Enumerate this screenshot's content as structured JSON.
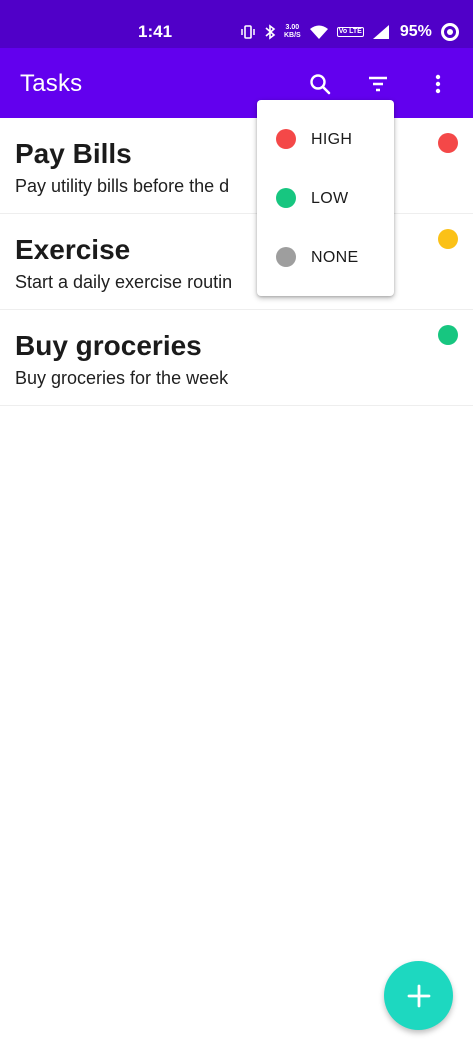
{
  "status_bar": {
    "time": "1:41",
    "speed_value": "3.00",
    "speed_unit": "KB/S",
    "volte_label": "Vo LTE",
    "battery": "95%"
  },
  "app_bar": {
    "title": "Tasks",
    "actions": [
      "search-icon",
      "filter-icon",
      "more-vert-icon"
    ],
    "color": "#6200ee"
  },
  "tasks": [
    {
      "title": "Pay Bills",
      "description": "Pay utility bills before the d",
      "priority_color": "#f44848"
    },
    {
      "title": "Exercise",
      "description": "Start a daily exercise routin",
      "priority_color": "#fbc117"
    },
    {
      "title": "Buy groceries",
      "description": "Buy groceries for the week",
      "priority_color": "#17c680"
    }
  ],
  "filter_menu": {
    "items": [
      {
        "label": "HIGH",
        "color": "#f44848"
      },
      {
        "label": "LOW",
        "color": "#17c680"
      },
      {
        "label": "NONE",
        "color": "#9e9e9e"
      }
    ]
  },
  "fab": {
    "icon": "add-icon",
    "color": "#1dd8c0"
  }
}
